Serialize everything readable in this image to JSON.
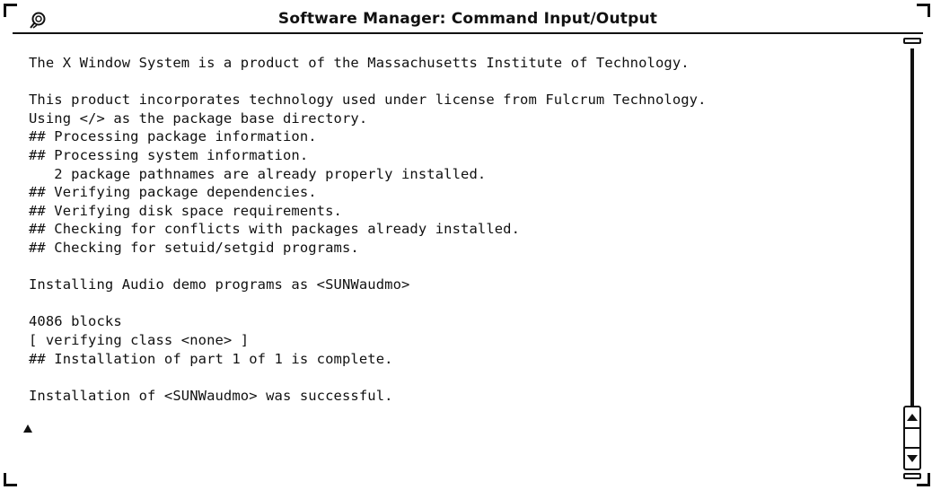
{
  "window": {
    "title": "Software Manager: Command Input/Output"
  },
  "output_lines": [
    "The X Window System is a product of the Massachusetts Institute of Technology.",
    "",
    "This product incorporates technology used under license from Fulcrum Technology.",
    "Using </> as the package base directory.",
    "## Processing package information.",
    "## Processing system information.",
    "   2 package pathnames are already properly installed.",
    "## Verifying package dependencies.",
    "## Verifying disk space requirements.",
    "## Checking for conflicts with packages already installed.",
    "## Checking for setuid/setgid programs.",
    "",
    "Installing Audio demo programs as <SUNWaudmo>",
    "",
    "4086 blocks",
    "[ verifying class <none> ]",
    "## Installation of part 1 of 1 is complete.",
    "",
    "Installation of <SUNWaudmo> was successful."
  ],
  "icons": {
    "window_menu": "window-menu-icon",
    "input_caret": "input-caret-icon",
    "scroll_up": "scroll-up-arrow-icon",
    "scroll_down": "scroll-down-arrow-icon"
  },
  "scrollbar": {
    "position_fraction": 1.0
  },
  "colors": {
    "foreground": "#111111",
    "background": "#ffffff"
  }
}
